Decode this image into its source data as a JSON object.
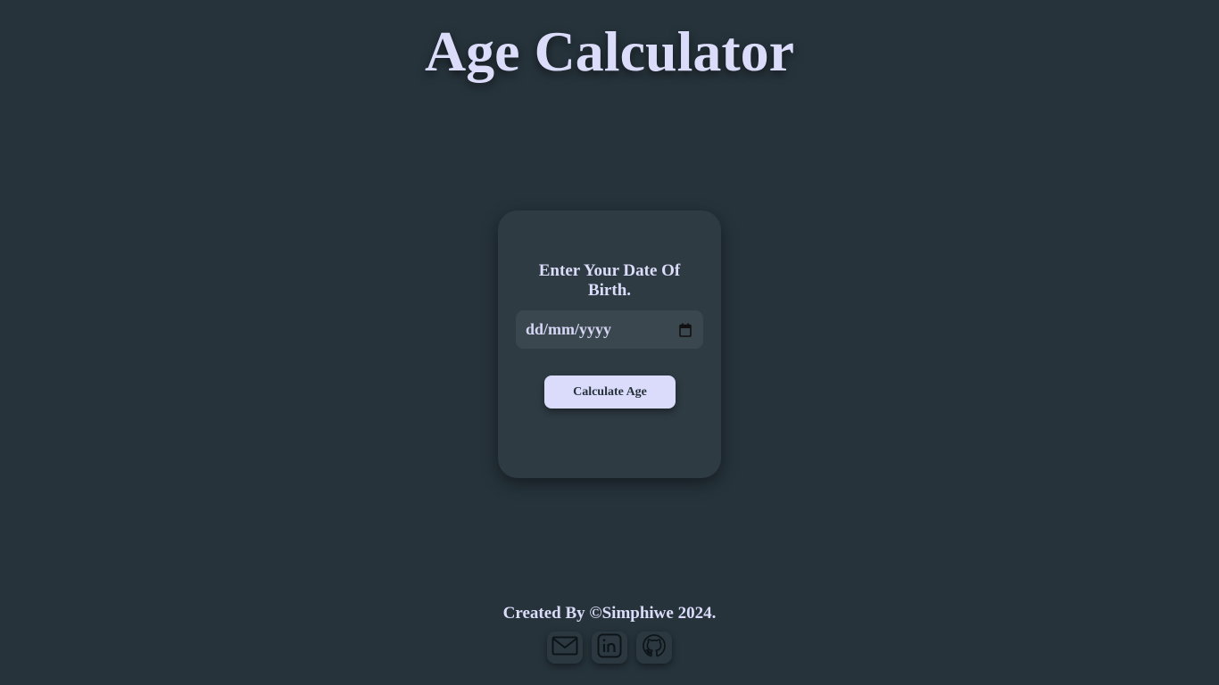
{
  "header": {
    "title": "Age Calculator"
  },
  "card": {
    "prompt": "Enter Your Date Of Birth.",
    "date_input": {
      "placeholder": "dd/mm/yyyy",
      "value": "",
      "icon": "calendar-icon"
    },
    "calculate_label": "Calculate Age"
  },
  "footer": {
    "credit": "Created By ©Simphiwe 2024.",
    "social_links": [
      {
        "icon": "mail-icon"
      },
      {
        "icon": "linkedin-icon"
      },
      {
        "icon": "github-icon"
      }
    ]
  },
  "colors": {
    "background": "#26333b",
    "card": "#2e3b43",
    "input": "#3a474f",
    "accent": "#dbdcfc",
    "text": "#dbdcf9"
  }
}
